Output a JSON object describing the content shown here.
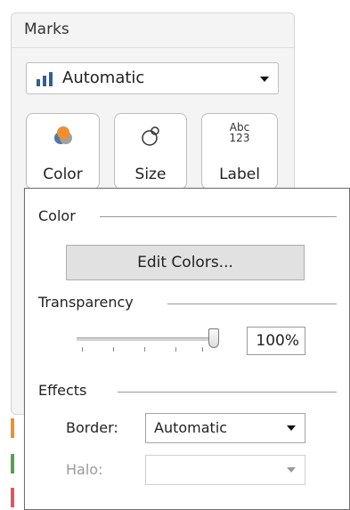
{
  "marks": {
    "title": "Marks",
    "mark_type": {
      "selected": "Automatic",
      "icon": "bar-chart-icon"
    },
    "shelves": [
      {
        "label": "Color",
        "icon": "color-palette-icon"
      },
      {
        "label": "Size",
        "icon": "size-circles-icon"
      },
      {
        "label": "Label",
        "icon": "abc-123-icon",
        "icon_text_top": "Abc",
        "icon_text_bottom": "123"
      }
    ]
  },
  "popup": {
    "color_section": {
      "title": "Color",
      "edit_button": "Edit Colors..."
    },
    "transparency_section": {
      "title": "Transparency",
      "value": "100%",
      "level_percent": 100
    },
    "effects_section": {
      "title": "Effects",
      "border": {
        "label": "Border:",
        "value": "Automatic"
      },
      "halo": {
        "label": "Halo:",
        "value": ""
      }
    }
  },
  "colors": {
    "strip_orange": "#f28e2b",
    "strip_green": "#59a14f",
    "strip_red": "#e15759",
    "color_icon_orange": "#f28e2b",
    "color_icon_blue": "#4e79a7",
    "bar_icon": "#2f5f9e"
  }
}
